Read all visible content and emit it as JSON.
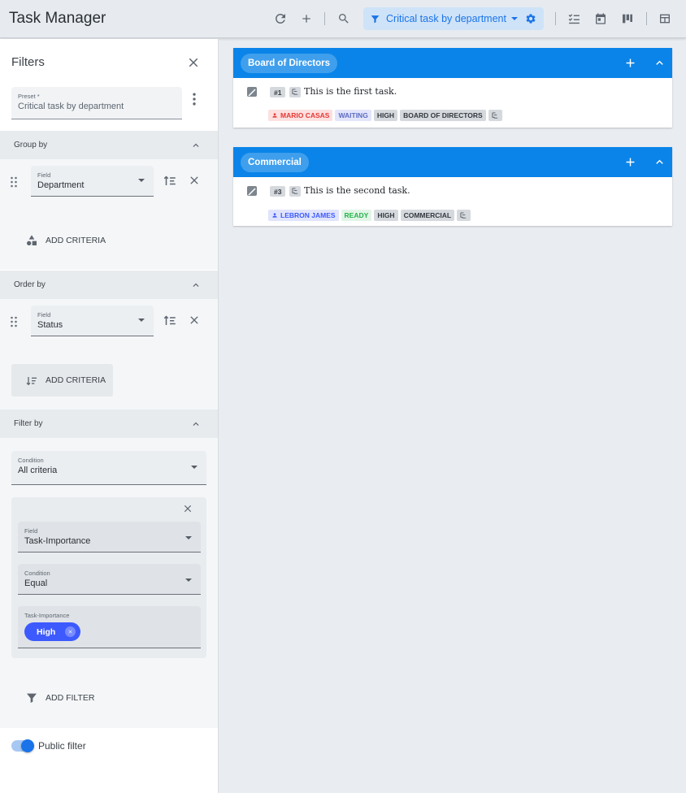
{
  "app": {
    "title": "Task Manager"
  },
  "toolbar": {
    "preset_label": "Critical task by department",
    "icons": [
      "refresh-icon",
      "add-icon",
      "search-icon",
      "filter-icon",
      "gear-icon",
      "checklist-view-icon",
      "calendar-view-icon",
      "kanban-view-icon",
      "table-view-icon"
    ],
    "accent": "#1a73e8"
  },
  "sidebar": {
    "title": "Filters",
    "preset": {
      "label": "Preset *",
      "value": "Critical task by department"
    },
    "group_by": {
      "heading": "Group by",
      "criteria": [
        {
          "field_label": "Field",
          "field_value": "Department"
        }
      ],
      "add_label": "ADD CRITERIA"
    },
    "order_by": {
      "heading": "Order by",
      "criteria": [
        {
          "field_label": "Field",
          "field_value": "Status"
        }
      ],
      "add_label": "ADD CRITERIA"
    },
    "filter_by": {
      "heading": "Filter by",
      "condition": {
        "label": "Condition",
        "value": "All criteria"
      },
      "rule": {
        "field": {
          "label": "Field",
          "value": "Task-Importance"
        },
        "condition": {
          "label": "Condition",
          "value": "Equal"
        },
        "values": {
          "label": "Task-Importance",
          "chips": [
            "High"
          ]
        }
      },
      "add_label": "ADD FILTER"
    },
    "public_filter": {
      "label": "Public filter",
      "enabled": true
    }
  },
  "groups": [
    {
      "name": "Board of Directors",
      "tasks": [
        {
          "id": "#1",
          "title": "This is the first task.",
          "assignee": "MARIO CASAS",
          "status": "WAITING",
          "importance": "HIGH",
          "department": "BOARD OF DIRECTORS"
        }
      ]
    },
    {
      "name": "Commercial",
      "tasks": [
        {
          "id": "#3",
          "title": "This is the second task.",
          "assignee": "LEBRON JAMES",
          "status": "READY",
          "importance": "HIGH",
          "department": "COMMERCIAL"
        }
      ]
    }
  ],
  "colors": {
    "group_header": "#0a84e8",
    "assignee_red_bg": "#fde0e0",
    "assignee_red_fg": "#e53935",
    "assignee_blue_bg": "#e0e4fc",
    "assignee_blue_fg": "#3d5afe",
    "status_waiting_bg": "#e3e5fb",
    "status_waiting_fg": "#5c6bc0",
    "status_ready_bg": "#e1f5e6",
    "status_ready_fg": "#22b34a",
    "neutral_tag_bg": "#d5d9de",
    "chip": "#3d5afe"
  }
}
